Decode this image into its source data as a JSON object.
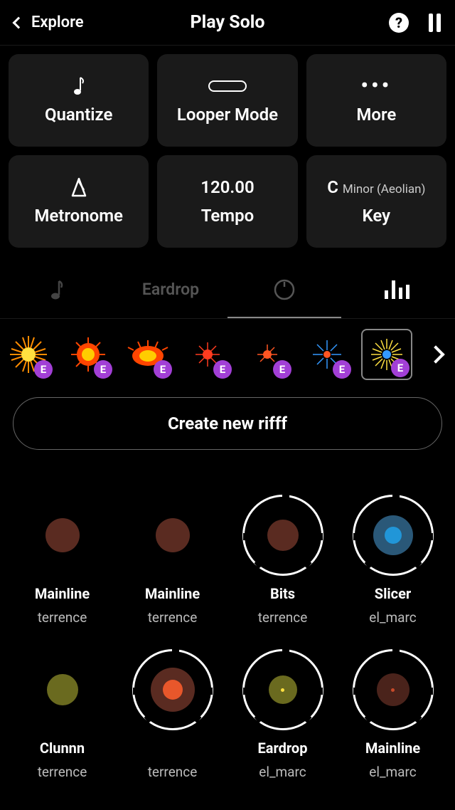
{
  "header": {
    "back_label": "Explore",
    "title": "Play Solo"
  },
  "controls": {
    "quantize": "Quantize",
    "looper": "Looper Mode",
    "more": "More",
    "metronome": "Metronome",
    "tempo_value": "120.00",
    "tempo_label": "Tempo",
    "key_root": "C",
    "key_scale": "Minor (Aeolian)",
    "key_label": "Key"
  },
  "tabs": {
    "eardrop": "Eardrop"
  },
  "sound_strip": {
    "badge": "E"
  },
  "create_button": "Create new rifff",
  "instruments": [
    {
      "name": "Mainline",
      "author": "terrence"
    },
    {
      "name": "Mainline",
      "author": "terrence"
    },
    {
      "name": "Bits",
      "author": "terrence"
    },
    {
      "name": "Slicer",
      "author": "el_marc"
    },
    {
      "name": "Clunnn",
      "author": "terrence"
    },
    {
      "name": "",
      "author": "terrence"
    },
    {
      "name": "Eardrop",
      "author": "el_marc"
    },
    {
      "name": "Mainline",
      "author": "el_marc"
    }
  ],
  "colors": {
    "tile_bg": "#1a1a1a",
    "brown": "#5a2b21",
    "olive": "#6a6a1f",
    "orange": "#e8572b",
    "blue_ring": "#2a5878",
    "blue_center": "#2196d8",
    "purple_badge": "#a23fd6"
  }
}
